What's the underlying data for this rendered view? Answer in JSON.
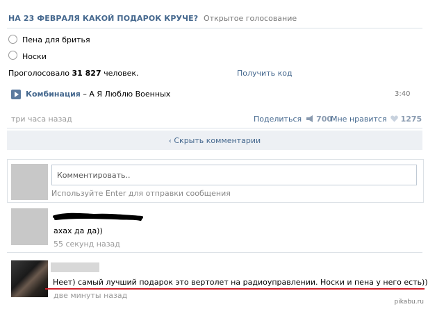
{
  "poll": {
    "title": "НА 23 ФЕВРАЛЯ КАКОЙ ПОДАРОК КРУЧЕ?",
    "type": "Открытое голосование",
    "options": [
      "Пена для бритья",
      "Носки"
    ],
    "voted_prefix": "Проголосовало ",
    "voted_count": "31 827",
    "voted_suffix": " человек.",
    "get_code": "Получить код"
  },
  "audio": {
    "artist": "Комбинация",
    "separator": " – ",
    "title": "А Я Люблю Военных",
    "duration": "3:40",
    "icon": "play-icon"
  },
  "post_meta": {
    "time": "три часа назад",
    "share_label": "Поделиться",
    "share_count": "700",
    "like_label": "Мне нравится",
    "like_count": "1275"
  },
  "hide_comments": "Скрыть комментарии",
  "comment_form": {
    "placeholder": "Комментировать..",
    "hint": "Используйте Enter для отправки сообщения"
  },
  "comments": [
    {
      "text": "ахах да да))",
      "time": "55 секунд назад"
    },
    {
      "text": "Неет) самый лучший подарок это вертолет на радиоуправлении. Носки и пена у него есть))",
      "time": "две минуты назад"
    }
  ],
  "watermark": "pikabu.ru",
  "colors": {
    "link": "#45688e",
    "muted": "#999999",
    "scribble": "#000000",
    "underline": "#d0202a"
  }
}
